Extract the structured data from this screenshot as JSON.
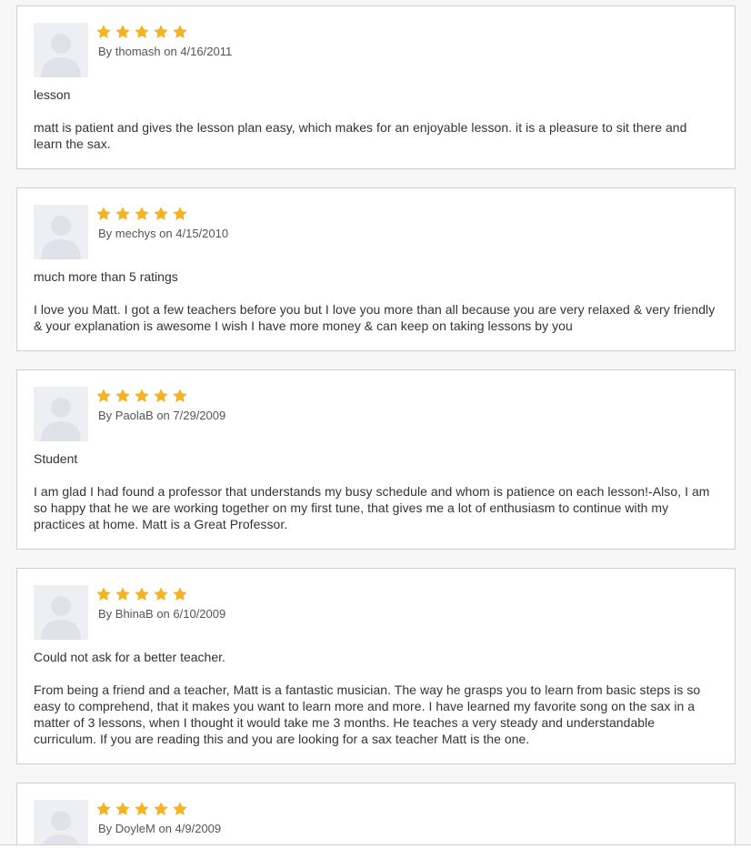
{
  "colors": {
    "star": "#f5b324",
    "card_border": "#cfcfcf",
    "avatar_bg": "#edeff3",
    "avatar_silhouette": "#dfe2e8",
    "text": "#333333"
  },
  "icons": {
    "avatar": "default-user-avatar-icon",
    "rating_star": "star-filled-icon"
  },
  "reviews": [
    {
      "rating": 5,
      "byline": "By thomash on 4/16/2011",
      "title": "lesson",
      "body": "matt is patient and gives the lesson plan easy, which makes for an enjoyable lesson. it is a pleasure to sit there and learn the sax."
    },
    {
      "rating": 5,
      "byline": "By mechys on 4/15/2010",
      "title": "much more than 5 ratings",
      "body": "I love you Matt. I got a few teachers before you but I love you more than all because you are very relaxed & very friendly & your explanation is awesome I wish I have more money & can keep on taking lessons by you"
    },
    {
      "rating": 5,
      "byline": "By PaolaB on 7/29/2009",
      "title": "Student",
      "body": "I am glad I had found a professor that understands my busy schedule and whom is patience on each lesson!-Also, I am so happy that he we are working together on my first tune, that gives me a lot of enthusiasm to continue with my practices at home. Matt is a Great Professor."
    },
    {
      "rating": 5,
      "byline": "By BhinaB on 6/10/2009",
      "title": "Could not ask for a better teacher.",
      "body": "From being a friend and a teacher, Matt is a fantastic musician. The way he grasps you to learn from basic steps is so easy to comprehend, that it makes you want to learn more and more. I have learned my favorite song on the sax in a matter of 3 lessons, when I thought it would take me 3 months. He teaches a very steady and understandable curriculum. If you are reading this and you are looking for a sax teacher Matt is the one."
    },
    {
      "rating": 5,
      "byline": "By DoyleM on 4/9/2009",
      "title": "",
      "body": ""
    }
  ]
}
